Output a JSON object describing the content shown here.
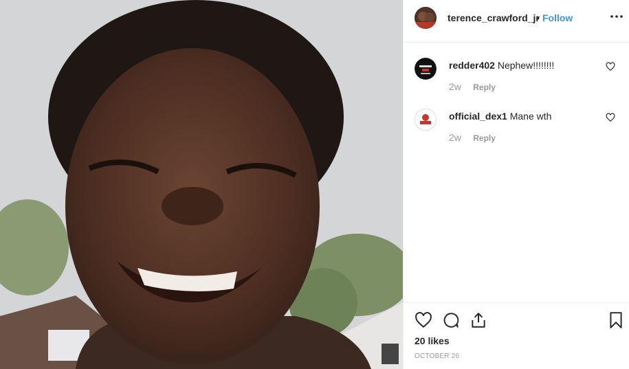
{
  "post": {
    "username": "terence_crawford_jr",
    "separator": "•",
    "follow_label": "Follow",
    "more_icon": "more-options-icon"
  },
  "comments": [
    {
      "username": "redder402",
      "text": "Nephew!!!!!!!!",
      "age": "2w",
      "reply_label": "Reply"
    },
    {
      "username": "official_dex1",
      "text": "Mane wth",
      "age": "2w",
      "reply_label": "Reply"
    }
  ],
  "actions": {
    "likes": "20 likes",
    "date": "OCTOBER 26",
    "icons": [
      "heart-icon",
      "comment-icon",
      "share-icon",
      "bookmark-icon"
    ]
  },
  "colors": {
    "link": "#3897f0",
    "text": "#262626",
    "muted": "#999999",
    "border": "#efefef"
  }
}
